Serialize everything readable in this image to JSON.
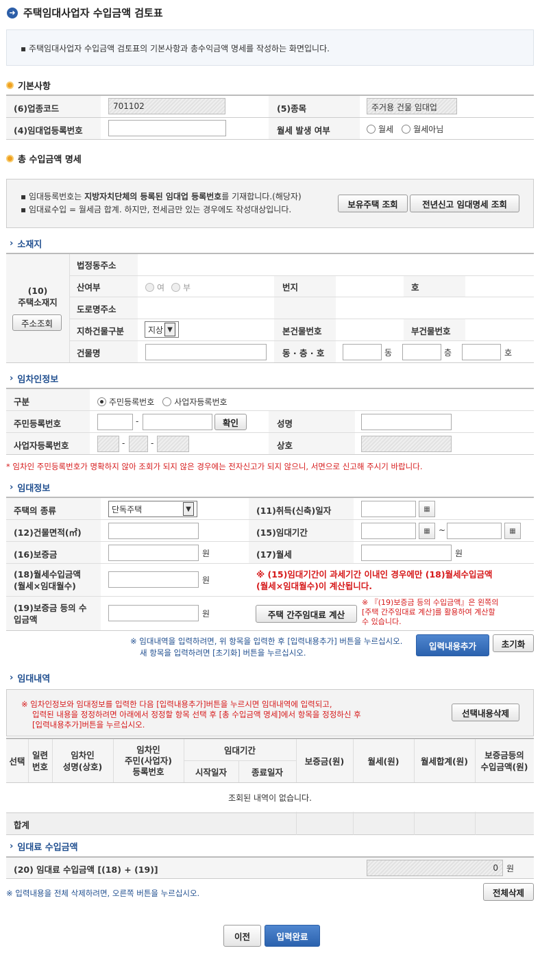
{
  "title": "주택임대사업자 수입금액 검토표",
  "info": "주택임대사업자 수입금액 검토표의 기본사항과 총수익금액 명세를 작성하는 화면입니다.",
  "basic": {
    "heading": "기본사항",
    "industry_code_label": "(6)업종코드",
    "industry_code_value": "701102",
    "type_label": "(5)종목",
    "type_value": "주거용 건물 임대업",
    "reg_no_label": "(4)임대업등록번호",
    "monthly_label": "월세 발생 여부",
    "monthly_yes": "월세",
    "monthly_no": "월세아님"
  },
  "total": {
    "heading": "총 수입금액 명세",
    "note1_a": "임대등록번호는 ",
    "note1_b": "지방자치단체의 등록된 임대업 등록번호",
    "note1_c": "를 기재합니다.(해당자)",
    "note2": "임대료수입 = 월세금 합계. 하지만, 전세금만 있는 경우에도 작성대상입니다.",
    "btn_owned": "보유주택 조회",
    "btn_prev": "전년신고 임대명세 조회"
  },
  "location": {
    "heading": "소재지",
    "label_line1": "(10)",
    "label_line2": "주택소재지",
    "addr_btn": "주소조회",
    "legal_addr": "법정동주소",
    "mountain": "산여부",
    "yes": "여",
    "no": "부",
    "bunji": "번지",
    "ho": "호",
    "road_addr": "도로명주소",
    "underground": "지하건물구분",
    "underground_value": "지상",
    "main_bldg": "본건물번호",
    "sub_bldg": "부건물번호",
    "bldg_name": "건물명",
    "dong_floor_ho": "동 · 층 · 호",
    "dong": "동",
    "floor": "층",
    "ho2": "호"
  },
  "tenant": {
    "heading": "임차인정보",
    "type_label": "구분",
    "opt_resident": "주민등록번호",
    "opt_business": "사업자등록번호",
    "resident_label": "주민등록번호",
    "confirm_btn": "확인",
    "name_label": "성명",
    "business_label": "사업자등록번호",
    "company_label": "상호",
    "warning": "* 임차인 주민등록번호가 명확하지 않아 조회가 되지 않은 경우에는 전자신고가 되지 않으니, 서면으로 신고해 주시기 바랍니다."
  },
  "rent": {
    "heading": "임대정보",
    "house_type_label": "주택의 종류",
    "house_type_value": "단독주택",
    "acquire_label": "(11)취득(신축)일자",
    "area_label": "(12)건물면적(㎡)",
    "period_label": "(15)임대기간",
    "tilde": "~",
    "deposit_label": "(16)보증금",
    "won": "원",
    "monthly_rent_label": "(17)월세",
    "monthly_income_label_1": "(18)월세수입금액",
    "monthly_income_label_2": "(월세×임대월수)",
    "calc_note_1": "※ (15)임대기간이 과세기간 이내인 경우에만 (18)월세수입금액",
    "calc_note_2": "(월세×임대월수)이 계산됩니다.",
    "deposit_income_label_1": "(19)보증금 등의 수",
    "deposit_income_label_2": "입금액",
    "calc_btn": "주택 간주임대료 계산",
    "deposit_note_1": "※ 『(19)보증금 등의 수입금액』은 왼쪽의",
    "deposit_note_2": "[주택 간주임대료 계산]를 활용하여 계산할",
    "deposit_note_3": "수 있습니다.",
    "add_note_1": "※ 임대내역을 입력하려면, 위 항목을 입력한 후 [입력내용추가] 버튼을 누르십시오.",
    "add_note_2": "새 항목을 입력하려면 [초기화] 버튼을 누르십시오.",
    "add_btn": "입력내용추가",
    "reset_btn": "초기화"
  },
  "history": {
    "heading": "임대내역",
    "note_1": "※ 임차인정보와 임대정보를 입력한 다음 [입력내용추가]버튼을 누르시면 임대내역에 입력되고,",
    "note_2": "입력된 내용을 정정하려면 아래에서 정정할 항목 선택 후 [총 수입금액 명세]에서 항목을 정정하신 후",
    "note_3": "[입력내용추가]버튼을 누르십시오.",
    "delete_sel_btn": "선택내용삭제",
    "col_select": "선택",
    "col_serial_1": "일련",
    "col_serial_2": "번호",
    "col_tenant_1": "임차인",
    "col_tenant_2": "성명(상호)",
    "col_tenant_id_1": "임차인",
    "col_tenant_id_2": "주민(사업자)",
    "col_tenant_id_3": "등록번호",
    "col_period": "임대기간",
    "col_start": "시작일자",
    "col_end": "종료일자",
    "col_deposit": "보증금(원)",
    "col_monthly": "월세(원)",
    "col_monthly_sum": "월세합계(원)",
    "col_deposit_income_1": "보증금등의",
    "col_deposit_income_2": "수입금액(원)",
    "empty": "조회된 내역이 없습니다.",
    "total": "합계"
  },
  "income": {
    "heading": "임대료 수입금액",
    "label": "(20) 임대료 수입금액 [(18) + (19)]",
    "value": "0",
    "unit": "원"
  },
  "footer": {
    "delete_all_note": "※ 입력내용을 전체 삭제하려면, 오른쪽 버튼을 누르십시오.",
    "delete_all_btn": "전체삭제",
    "prev_btn": "이전",
    "done_btn": "입력완료"
  }
}
